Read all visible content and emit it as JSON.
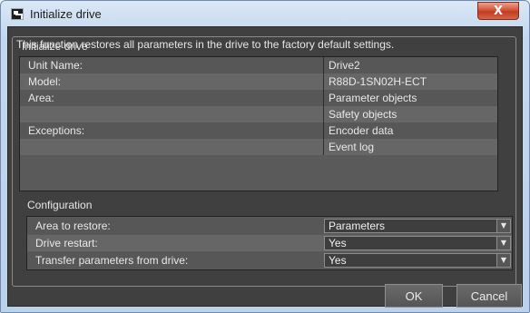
{
  "window": {
    "title": "Initialize drive",
    "close_symbol": "X",
    "app_icon": "drive-app-icon"
  },
  "group": {
    "legend": "Initialize drive",
    "description": "This function restores all parameters in the drive to the factory default settings."
  },
  "info_rows": [
    {
      "label": "Unit Name:",
      "value": "Drive2"
    },
    {
      "label": "Model:",
      "value": "R88D-1SN02H-ECT"
    },
    {
      "label": "Area:",
      "value": "Parameter objects"
    },
    {
      "label": "",
      "value": "Safety objects"
    },
    {
      "label": "Exceptions:",
      "value": "Encoder data"
    },
    {
      "label": "",
      "value": "Event log"
    }
  ],
  "configuration": {
    "title": "Configuration",
    "rows": [
      {
        "label": "Area to restore:",
        "value": "Parameters"
      },
      {
        "label": "Drive restart:",
        "value": "Yes"
      },
      {
        "label": "Transfer parameters from drive:",
        "value": "Yes"
      }
    ],
    "dropdown_arrow": "▼"
  },
  "buttons": {
    "ok": "OK",
    "cancel": "Cancel"
  }
}
